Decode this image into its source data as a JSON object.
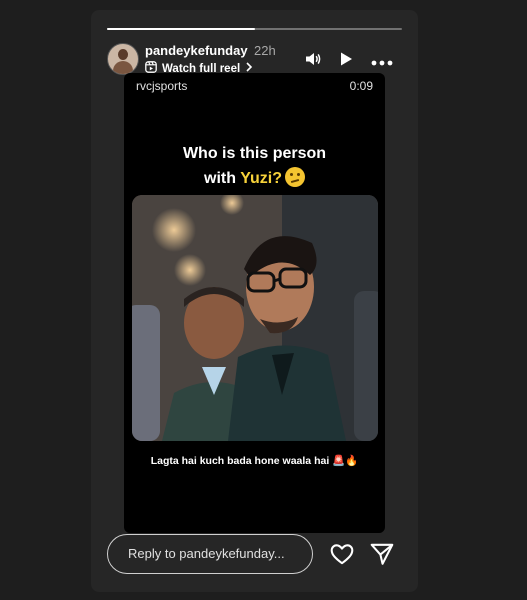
{
  "story": {
    "progress": 0.5,
    "username": "pandeykefunday",
    "posted_ago": "22h",
    "reel_link_label": "Watch full reel"
  },
  "controls": {
    "mute_icon": "speaker-icon",
    "play_icon": "play-icon",
    "more_icon": "more-options-icon"
  },
  "video": {
    "source": "rvcjsports",
    "duration": "0:09",
    "headline_line1": "Who is this person",
    "headline_line2_prefix": "with ",
    "headline_highlight": "Yuzi?",
    "headline_highlight_color": "#f7d23a",
    "caption": "Lagta hai kuch bada hone waala hai 🚨🔥"
  },
  "reply": {
    "placeholder": "Reply to pandeykefunday..."
  },
  "actions": {
    "like_icon": "heart-icon",
    "share_icon": "send-icon"
  }
}
